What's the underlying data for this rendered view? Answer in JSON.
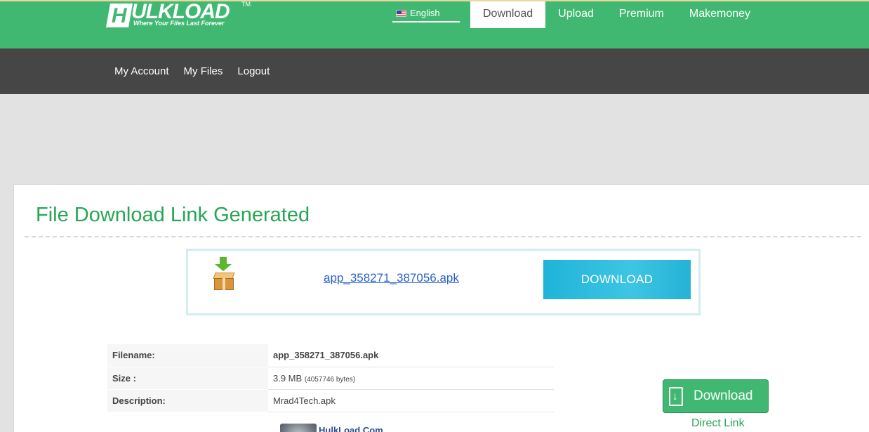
{
  "brand": {
    "name": "ULKLOAD",
    "initial": "H",
    "trademark": "TM",
    "tagline": "Where Your Files Last Forever"
  },
  "language": {
    "label": "English"
  },
  "topnav": [
    {
      "label": "Download",
      "active": true
    },
    {
      "label": "Upload"
    },
    {
      "label": "Premium"
    },
    {
      "label": "Makemoney"
    }
  ],
  "subnav": [
    {
      "label": "My Account"
    },
    {
      "label": "My Files"
    },
    {
      "label": "Logout"
    }
  ],
  "main": {
    "title": "File Download Link Generated",
    "file_link": "app_358271_387056.apk",
    "download_button": "DOWNLOAD",
    "details": {
      "filename_label": "Filename:",
      "filename_value": "app_358271_387056.apk",
      "size_label": "Size :",
      "size_value": "3.9 MB",
      "size_bytes": "(4057746 bytes)",
      "description_label": "Description:",
      "description_value": "Mrad4Tech.apk"
    },
    "thumb_title": "HulkLoad.Com",
    "green_button": "Download",
    "direct_link": "Direct Link"
  },
  "colors": {
    "brand_green": "#41b872",
    "title_green": "#26a655",
    "dark_bar": "#464646",
    "download_blue": "#1fb4d8"
  }
}
